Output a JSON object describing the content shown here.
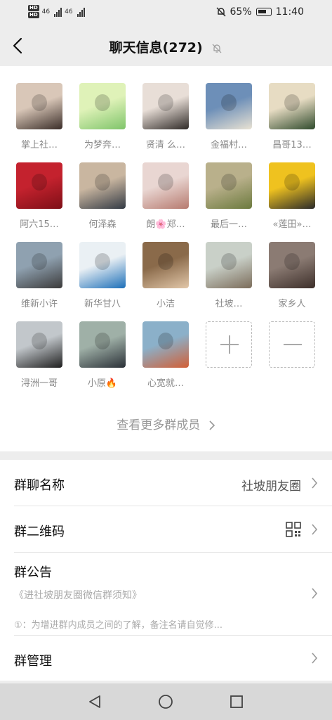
{
  "status": {
    "hd1": "HD",
    "hd2": "HD",
    "net1": "46",
    "net2": "46",
    "battery": "65%",
    "time": "11:40"
  },
  "nav": {
    "title": "聊天信息(272)"
  },
  "members": [
    {
      "name": "掌上社…"
    },
    {
      "name": "为梦奔…"
    },
    {
      "name": "贤清 么…"
    },
    {
      "name": "金福村…"
    },
    {
      "name": "昌哥13…"
    },
    {
      "name": "阿六15…"
    },
    {
      "name": "何泽森"
    },
    {
      "name": "朗🌸郑…"
    },
    {
      "name": "最后一…"
    },
    {
      "name": "«莲田»…"
    },
    {
      "name": "维新小许"
    },
    {
      "name": "新华甘八"
    },
    {
      "name": "小洁"
    },
    {
      "name": "社坡…"
    },
    {
      "name": "家乡人"
    },
    {
      "name": "浔洲一哥"
    },
    {
      "name": "小原🔥"
    },
    {
      "name": "心宽就…"
    }
  ],
  "more_members": "查看更多群成员",
  "group_name": {
    "label": "群聊名称",
    "value": "社坡朋友圈"
  },
  "qr_code": {
    "label": "群二维码"
  },
  "notice": {
    "label": "群公告",
    "subtitle": "《进社坡朋友圈微信群须知》",
    "body": "①：为增进群内成员之间的了解，备注名请自觉修..."
  },
  "manage": {
    "label": "群管理"
  }
}
